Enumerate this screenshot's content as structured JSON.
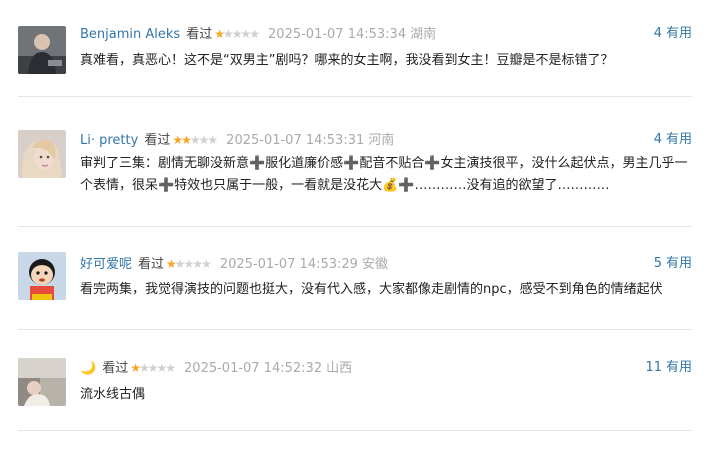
{
  "comments": [
    {
      "author": "Benjamin Aleks",
      "status": "看过",
      "rating": 1,
      "time": "2025-01-07 14:53:34",
      "location": "湖南",
      "useful_count": "4",
      "useful_label": "有用",
      "text": "真难看，真恶心！这不是“双男主”剧吗？哪来的女主啊，我没看到女主！豆瓣是不是标错了？"
    },
    {
      "author": "Li· pretty",
      "status": "看过",
      "rating": 2,
      "time": "2025-01-07 14:53:31",
      "location": "河南",
      "useful_count": "4",
      "useful_label": "有用",
      "text": "审判了三集：剧情无聊没新意➕服化道廉价感➕配音不贴合➕女主演技很平，没什么起伏点，男主几乎一个表情，很呆➕特效也只属于一般，一看就是没花大💰➕…………没有追的欲望了…………"
    },
    {
      "author": "好可爱呢",
      "status": "看过",
      "rating": 1,
      "time": "2025-01-07 14:53:29",
      "location": "安徽",
      "useful_count": "5",
      "useful_label": "有用",
      "text": "看完两集，我觉得演技的问题也挺大，没有代入感，大家都像走剧情的npc，感受不到角色的情绪起伏"
    },
    {
      "author": "🌙",
      "status": "看过",
      "rating": 1,
      "time": "2025-01-07 14:52:32",
      "location": "山西",
      "useful_count": "11",
      "useful_label": "有用",
      "text": "流水线古偶"
    }
  ]
}
